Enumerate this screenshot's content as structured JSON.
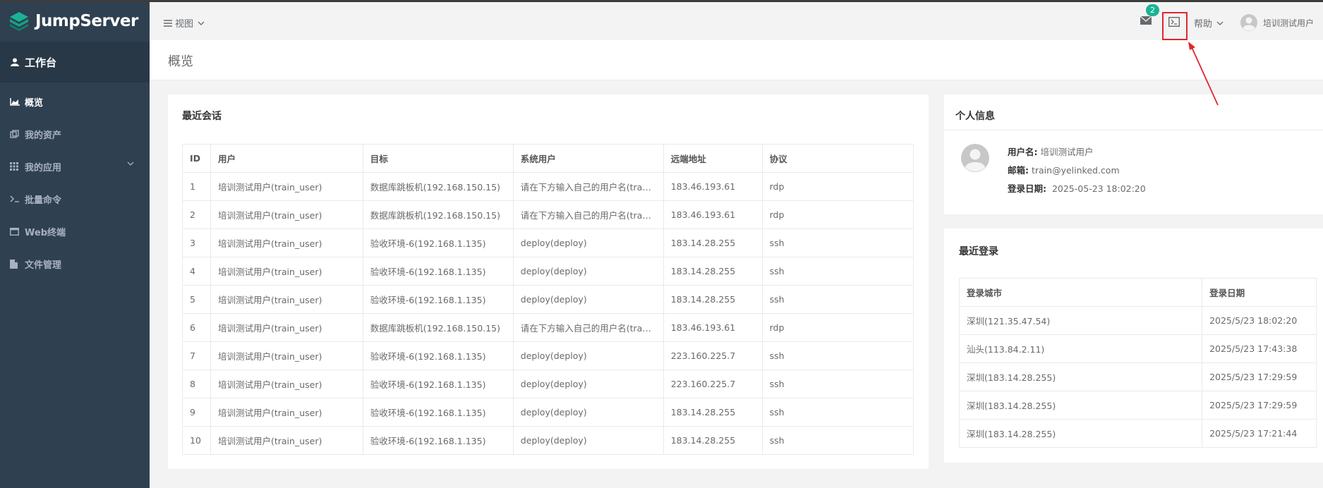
{
  "app": {
    "name": "JumpServer"
  },
  "sidebar": {
    "workbench": "工作台",
    "items": [
      {
        "label": "概览",
        "icon": "area-chart-icon",
        "active": true
      },
      {
        "label": "我的资产",
        "icon": "assets-icon"
      },
      {
        "label": "我的应用",
        "icon": "grid-icon",
        "has_children": true
      },
      {
        "label": "批量命令",
        "icon": "terminal-prompt-icon"
      },
      {
        "label": "Web终端",
        "icon": "window-icon"
      },
      {
        "label": "文件管理",
        "icon": "file-icon"
      }
    ]
  },
  "topbar": {
    "view_label": "视图",
    "mail_badge": "2",
    "help_label": "帮助",
    "user_name": "培训测试用户"
  },
  "page": {
    "title": "概览"
  },
  "recent_sessions": {
    "title": "最近会话",
    "columns": [
      "ID",
      "用户",
      "目标",
      "系统用户",
      "远端地址",
      "协议"
    ],
    "rows": [
      [
        "1",
        "培训测试用户(train_user)",
        "数据库跳板机(192.168.150.15)",
        "请在下方输入自己的用户名(tra…",
        "183.46.193.61",
        "rdp"
      ],
      [
        "2",
        "培训测试用户(train_user)",
        "数据库跳板机(192.168.150.15)",
        "请在下方输入自己的用户名(tra…",
        "183.46.193.61",
        "rdp"
      ],
      [
        "3",
        "培训测试用户(train_user)",
        "验收环境-6(192.168.1.135)",
        "deploy(deploy)",
        "183.14.28.255",
        "ssh"
      ],
      [
        "4",
        "培训测试用户(train_user)",
        "验收环境-6(192.168.1.135)",
        "deploy(deploy)",
        "183.14.28.255",
        "ssh"
      ],
      [
        "5",
        "培训测试用户(train_user)",
        "验收环境-6(192.168.1.135)",
        "deploy(deploy)",
        "183.14.28.255",
        "ssh"
      ],
      [
        "6",
        "培训测试用户(train_user)",
        "数据库跳板机(192.168.150.15)",
        "请在下方输入自己的用户名(tra…",
        "183.46.193.61",
        "rdp"
      ],
      [
        "7",
        "培训测试用户(train_user)",
        "验收环境-6(192.168.1.135)",
        "deploy(deploy)",
        "223.160.225.7",
        "ssh"
      ],
      [
        "8",
        "培训测试用户(train_user)",
        "验收环境-6(192.168.1.135)",
        "deploy(deploy)",
        "223.160.225.7",
        "ssh"
      ],
      [
        "9",
        "培训测试用户(train_user)",
        "验收环境-6(192.168.1.135)",
        "deploy(deploy)",
        "183.14.28.255",
        "ssh"
      ],
      [
        "10",
        "培训测试用户(train_user)",
        "验收环境-6(192.168.1.135)",
        "deploy(deploy)",
        "183.14.28.255",
        "ssh"
      ]
    ]
  },
  "personal_info": {
    "title": "个人信息",
    "username_label": "用户名:",
    "username": "培训测试用户",
    "email_label": "邮箱:",
    "email": "train@yelinked.com",
    "login_date_label": "登录日期:",
    "login_date": "2025-05-23 18:02:20"
  },
  "recent_logins": {
    "title": "最近登录",
    "columns": [
      "登录城市",
      "登录日期"
    ],
    "rows": [
      [
        "深圳(121.35.47.54)",
        "2025/5/23 18:02:20"
      ],
      [
        "汕头(113.84.2.11)",
        "2025/5/23 17:43:38"
      ],
      [
        "深圳(183.14.28.255)",
        "2025/5/23 17:29:59"
      ],
      [
        "深圳(183.14.28.255)",
        "2025/5/23 17:29:59"
      ],
      [
        "深圳(183.14.28.255)",
        "2025/5/23 17:21:44"
      ]
    ]
  },
  "colors": {
    "sidebar_bg": "#2f4050",
    "accent": "#1ab394",
    "highlight": "#e0262b"
  }
}
